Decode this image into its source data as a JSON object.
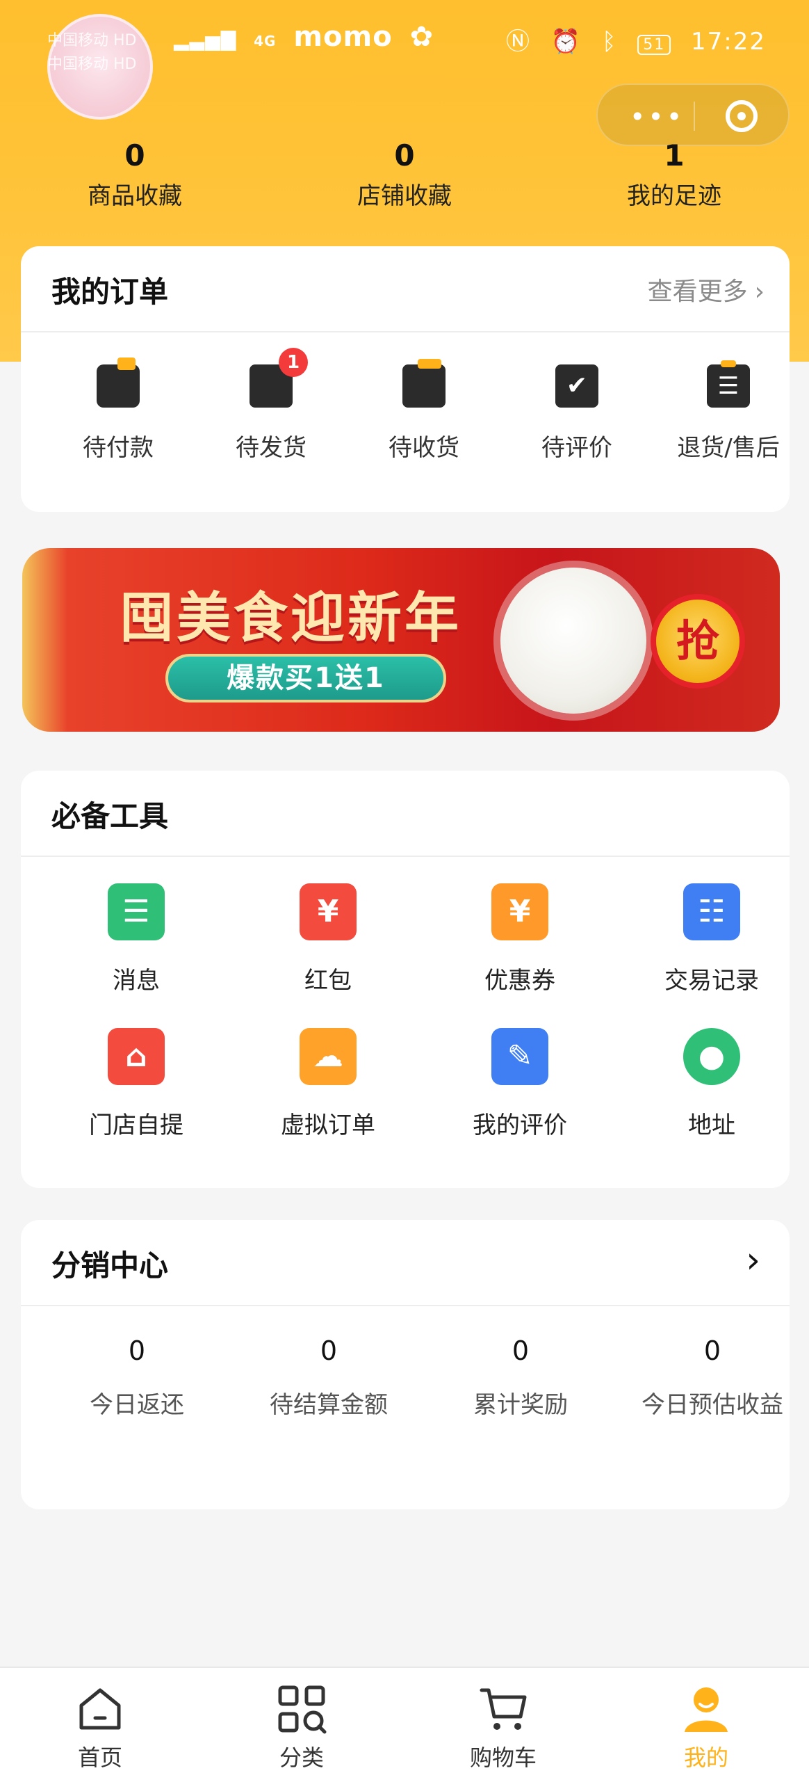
{
  "status_bar": {
    "carrier_1": "中国移动 HD",
    "carrier_2": "中国移动 HD",
    "network": "4G",
    "app_notification": "momo",
    "battery": "51",
    "time": "17:22"
  },
  "capsule": {
    "more_glyph": "•••",
    "target_icon": "target-icon"
  },
  "stats": [
    {
      "value": "0",
      "label": "商品收藏"
    },
    {
      "value": "0",
      "label": "店铺收藏"
    },
    {
      "value": "1",
      "label": "我的足迹"
    }
  ],
  "orders": {
    "title": "我的订单",
    "more_label": "查看更多",
    "items": [
      {
        "label": "待付款",
        "icon": "wallet-icon"
      },
      {
        "label": "待发货",
        "icon": "box-icon",
        "badge": "1"
      },
      {
        "label": "待收货",
        "icon": "package-icon"
      },
      {
        "label": "待评价",
        "icon": "check-icon"
      },
      {
        "label": "退货/售后",
        "icon": "document-icon"
      }
    ]
  },
  "banner": {
    "title": "囤美食迎新年",
    "pill": "爆款买1送1",
    "grab": "抢"
  },
  "tools": {
    "title": "必备工具",
    "items": [
      {
        "label": "消息",
        "icon": "message-icon"
      },
      {
        "label": "红包",
        "icon": "red-envelope-icon"
      },
      {
        "label": "优惠券",
        "icon": "coupon-icon"
      },
      {
        "label": "交易记录",
        "icon": "calendar-icon"
      },
      {
        "label": "门店自提",
        "icon": "store-icon"
      },
      {
        "label": "虚拟订单",
        "icon": "cloud-clipboard-icon"
      },
      {
        "label": "我的评价",
        "icon": "edit-icon"
      },
      {
        "label": "地址",
        "icon": "location-pin-icon"
      }
    ]
  },
  "distribution": {
    "title": "分销中心",
    "items": [
      {
        "value": "0",
        "label": "今日返还"
      },
      {
        "value": "0",
        "label": "待结算金额"
      },
      {
        "value": "0",
        "label": "累计奖励"
      },
      {
        "value": "0",
        "label": "今日预估收益"
      }
    ]
  },
  "tabbar": {
    "items": [
      {
        "label": "首页",
        "icon": "home-icon"
      },
      {
        "label": "分类",
        "icon": "grid-search-icon"
      },
      {
        "label": "购物车",
        "icon": "cart-icon"
      },
      {
        "label": "我的",
        "icon": "user-icon",
        "active": true
      }
    ],
    "active_color": "#ffb21a"
  },
  "colors": {
    "hero": "#ffc43b",
    "badge": "#f33b3b"
  }
}
